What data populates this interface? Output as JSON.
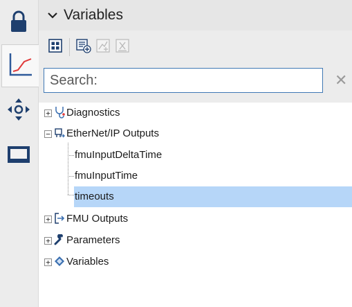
{
  "rail": {
    "items": [
      {
        "icon": "lock-icon"
      },
      {
        "icon": "chart-icon",
        "active": true
      },
      {
        "icon": "move-arrows-icon"
      },
      {
        "icon": "monitor-icon"
      }
    ]
  },
  "header": {
    "title": "Variables"
  },
  "toolbar": {
    "buttons": [
      "grid-view-icon",
      "add-variable-icon",
      "edit-formula-icon",
      "delete-variable-icon"
    ]
  },
  "search": {
    "placeholder": "Search:",
    "value": ""
  },
  "tree": {
    "nodes": [
      {
        "label": "Diagnostics",
        "icon": "diagnostics-icon",
        "expanded": false
      },
      {
        "label": "EtherNet/IP Outputs",
        "icon": "ethernet-ip-icon",
        "expanded": true,
        "children": [
          "fmuInputDeltaTime",
          "fmuInputTime",
          "timeouts"
        ]
      },
      {
        "label": "FMU Outputs",
        "icon": "fmu-outputs-icon",
        "expanded": false
      },
      {
        "label": "Parameters",
        "icon": "wrench-icon",
        "expanded": false
      },
      {
        "label": "Variables",
        "icon": "diamond-icon",
        "expanded": false
      }
    ],
    "selected": "timeouts"
  },
  "colors": {
    "accent": "#3f78b4",
    "selection": "#b6d6f8",
    "header_bg": "#e6e6e6",
    "panel_bg": "#ececec"
  }
}
